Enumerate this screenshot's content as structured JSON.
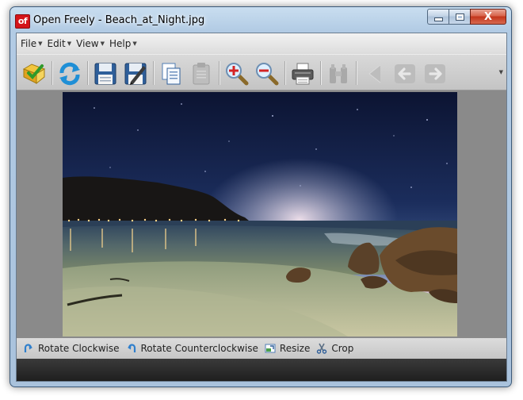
{
  "window": {
    "title": "Open Freely - Beach_at_Night.jpg",
    "app_icon_text": "of"
  },
  "window_controls": {
    "close_label": "X"
  },
  "menu": [
    {
      "label": "File"
    },
    {
      "label": "Edit"
    },
    {
      "label": "View"
    },
    {
      "label": "Help"
    }
  ],
  "toolbar": {
    "buttons": [
      {
        "icon": "open-folder-icon",
        "enabled": true
      },
      {
        "icon": "refresh-icon",
        "enabled": true
      },
      {
        "icon": "save-icon",
        "enabled": true
      },
      {
        "icon": "save-as-icon",
        "enabled": true
      },
      {
        "icon": "copy-icon",
        "enabled": true
      },
      {
        "icon": "paste-icon",
        "enabled": false
      },
      {
        "icon": "zoom-in-icon",
        "enabled": true
      },
      {
        "icon": "zoom-out-icon",
        "enabled": true
      },
      {
        "icon": "print-icon",
        "enabled": true
      },
      {
        "icon": "binoculars-icon",
        "enabled": false
      },
      {
        "icon": "first-icon",
        "enabled": false
      },
      {
        "icon": "previous-icon",
        "enabled": false
      },
      {
        "icon": "next-icon",
        "enabled": false
      }
    ]
  },
  "image": {
    "subject": "beach at night"
  },
  "actions": [
    {
      "label": "Rotate Clockwise",
      "icon": "rotate-clockwise-icon"
    },
    {
      "label": "Rotate Counterclockwise",
      "icon": "rotate-counterclockwise-icon"
    },
    {
      "label": "Resize",
      "icon": "resize-icon"
    },
    {
      "label": "Crop",
      "icon": "crop-icon"
    }
  ],
  "colors": {
    "close_button": "#c2341a",
    "app_icon": "#d4141a",
    "status_bar": "#2a2a2a"
  }
}
